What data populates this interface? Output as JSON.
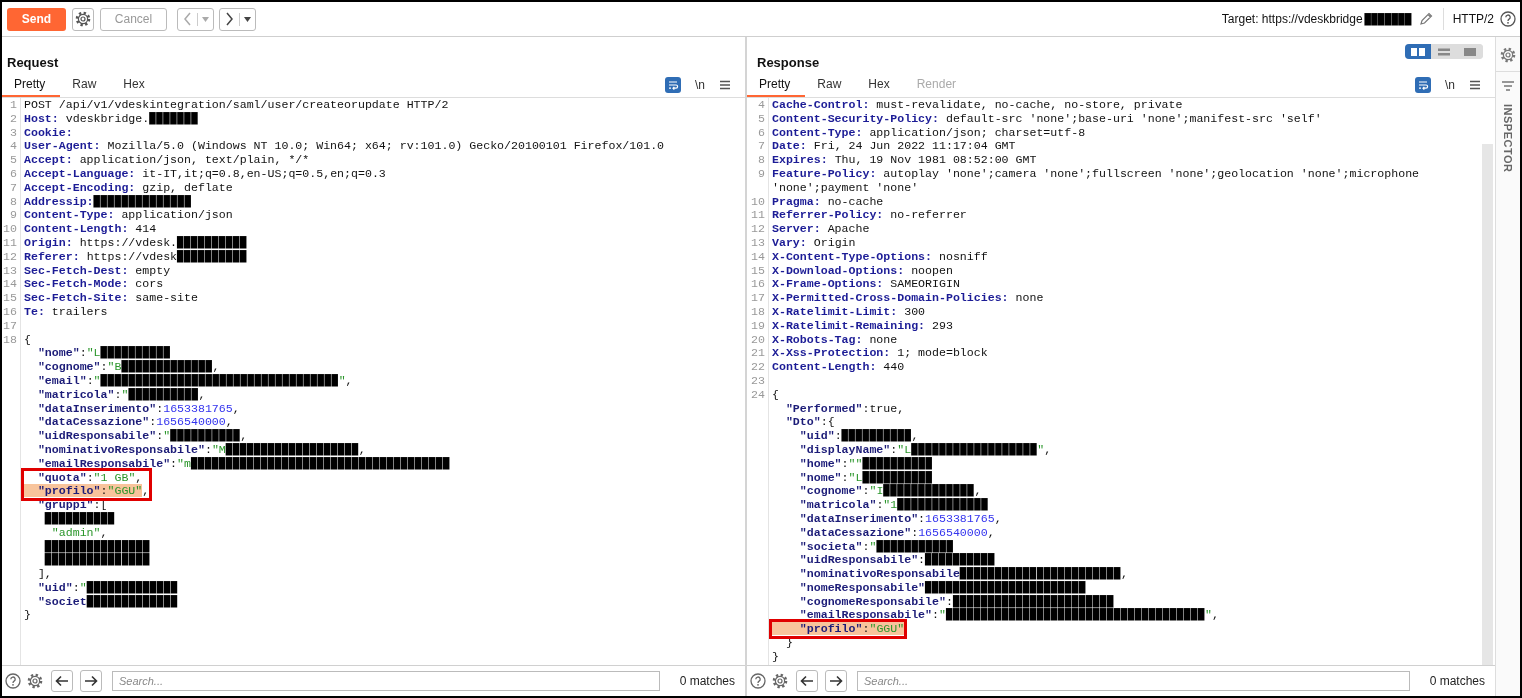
{
  "toolbar": {
    "send": {
      "label": "Send"
    },
    "cancel": {
      "label": "Cancel",
      "disabled": true
    },
    "history": [
      {
        "kind": "back",
        "disabled": true
      },
      {
        "kind": "forward",
        "disabled": false
      }
    ],
    "target": {
      "label": "Target: https://vdeskbridge",
      "redaction": "███████"
    },
    "protocol": "HTTP/2"
  },
  "request": {
    "kind": "request",
    "title": "Request",
    "tabs": [
      {
        "label": "Pretty",
        "selected": true
      },
      {
        "label": "Raw",
        "selected": false
      },
      {
        "label": "Hex",
        "selected": false
      }
    ],
    "newline_toggle": "\\n",
    "lines": [
      {
        "number": "1",
        "tokens": [
          {
            "kind": "text",
            "text": "POST /api/v1/vdeskintegration/saml/user/createorupdate HTTP/2"
          }
        ]
      },
      {
        "number": "2",
        "tokens": [
          {
            "kind": "name",
            "text": "Host:"
          },
          {
            "kind": "text",
            "text": " vdeskbridge."
          },
          {
            "kind": "redacted",
            "text": "███████"
          }
        ]
      },
      {
        "number": "3",
        "tokens": [
          {
            "kind": "name",
            "text": "Cookie:"
          }
        ]
      },
      {
        "number": "4",
        "tokens": [
          {
            "kind": "name",
            "text": "User-Agent:"
          },
          {
            "kind": "text",
            "text": " Mozilla/5.0 (Windows NT 10.0; Win64; x64; rv:101.0) Gecko/20100101 Firefox/101.0"
          }
        ]
      },
      {
        "number": "5",
        "tokens": [
          {
            "kind": "name",
            "text": "Accept:"
          },
          {
            "kind": "text",
            "text": " application/json, text/plain, */*"
          }
        ]
      },
      {
        "number": "6",
        "tokens": [
          {
            "kind": "name",
            "text": "Accept-Language:"
          },
          {
            "kind": "text",
            "text": " it-IT,it;q=0.8,en-US;q=0.5,en;q=0.3"
          }
        ]
      },
      {
        "number": "7",
        "tokens": [
          {
            "kind": "name",
            "text": "Accept-Encoding:"
          },
          {
            "kind": "text",
            "text": " gzip, deflate"
          }
        ]
      },
      {
        "number": "8",
        "tokens": [
          {
            "kind": "name",
            "text": "Addressip:"
          },
          {
            "kind": "redacted",
            "text": "██████████████"
          }
        ]
      },
      {
        "number": "9",
        "tokens": [
          {
            "kind": "name",
            "text": "Content-Type:"
          },
          {
            "kind": "text",
            "text": " application/json"
          }
        ]
      },
      {
        "number": "10",
        "tokens": [
          {
            "kind": "name",
            "text": "Content-Length:"
          },
          {
            "kind": "text",
            "text": " 414"
          }
        ]
      },
      {
        "number": "11",
        "tokens": [
          {
            "kind": "name",
            "text": "Origin:"
          },
          {
            "kind": "text",
            "text": " https://vdesk."
          },
          {
            "kind": "redacted",
            "text": "██████████"
          }
        ]
      },
      {
        "number": "12",
        "tokens": [
          {
            "kind": "name",
            "text": "Referer:"
          },
          {
            "kind": "text",
            "text": " https://vdesk"
          },
          {
            "kind": "redacted",
            "text": "██████████"
          }
        ]
      },
      {
        "number": "13",
        "tokens": [
          {
            "kind": "name",
            "text": "Sec-Fetch-Dest:"
          },
          {
            "kind": "text",
            "text": " empty"
          }
        ]
      },
      {
        "number": "14",
        "tokens": [
          {
            "kind": "name",
            "text": "Sec-Fetch-Mode:"
          },
          {
            "kind": "text",
            "text": " cors"
          }
        ]
      },
      {
        "number": "15",
        "tokens": [
          {
            "kind": "name",
            "text": "Sec-Fetch-Site:"
          },
          {
            "kind": "text",
            "text": " same-site"
          }
        ]
      },
      {
        "number": "16",
        "tokens": [
          {
            "kind": "name",
            "text": "Te:"
          },
          {
            "kind": "text",
            "text": " trailers"
          }
        ]
      },
      {
        "number": "17"
      },
      {
        "number": "18",
        "tokens": [
          {
            "kind": "punct",
            "text": "{"
          }
        ]
      },
      {
        "tokens": [
          {
            "kind": "key",
            "text": "  \"nome\""
          },
          {
            "kind": "punct",
            "text": ":"
          },
          {
            "kind": "string",
            "text": "\"L"
          },
          {
            "kind": "redacted",
            "text": "██████████"
          }
        ]
      },
      {
        "tokens": [
          {
            "kind": "key",
            "text": "  \"cognome\""
          },
          {
            "kind": "punct",
            "text": ":"
          },
          {
            "kind": "string",
            "text": "\"B"
          },
          {
            "kind": "redacted",
            "text": "█████████████"
          },
          {
            "kind": "punct",
            "text": ","
          }
        ]
      },
      {
        "tokens": [
          {
            "kind": "key",
            "text": "  \"email\""
          },
          {
            "kind": "punct",
            "text": ":"
          },
          {
            "kind": "string",
            "text": "\""
          },
          {
            "kind": "redacted",
            "text": "██████████████████████████████████"
          },
          {
            "kind": "string",
            "text": "\""
          },
          {
            "kind": "punct",
            "text": ","
          }
        ]
      },
      {
        "tokens": [
          {
            "kind": "key",
            "text": "  \"matricola\""
          },
          {
            "kind": "punct",
            "text": ":"
          },
          {
            "kind": "string",
            "text": "\""
          },
          {
            "kind": "redacted",
            "text": "██████████"
          },
          {
            "kind": "punct",
            "text": ","
          }
        ]
      },
      {
        "tokens": [
          {
            "kind": "key",
            "text": "  \"dataInserimento\""
          },
          {
            "kind": "punct",
            "text": ":"
          },
          {
            "kind": "number",
            "text": "1653381765"
          },
          {
            "kind": "punct",
            "text": ","
          }
        ]
      },
      {
        "tokens": [
          {
            "kind": "key",
            "text": "  \"dataCessazione\""
          },
          {
            "kind": "punct",
            "text": ":"
          },
          {
            "kind": "number",
            "text": "1656540000"
          },
          {
            "kind": "punct",
            "text": ","
          }
        ]
      },
      {
        "tokens": [
          {
            "kind": "key",
            "text": "  \"uidResponsabile\""
          },
          {
            "kind": "punct",
            "text": ":"
          },
          {
            "kind": "string",
            "text": "\""
          },
          {
            "kind": "redacted",
            "text": "██████████"
          },
          {
            "kind": "punct",
            "text": ","
          }
        ]
      },
      {
        "tokens": [
          {
            "kind": "key",
            "text": "  \"nominativoResponsabile\""
          },
          {
            "kind": "punct",
            "text": ":"
          },
          {
            "kind": "string",
            "text": "\"M"
          },
          {
            "kind": "redacted",
            "text": "███████████████████"
          },
          {
            "kind": "punct",
            "text": ","
          }
        ]
      },
      {
        "tokens": [
          {
            "kind": "key",
            "text": "  \"emailResponsabile\""
          },
          {
            "kind": "punct",
            "text": ":"
          },
          {
            "kind": "string",
            "text": "\"m"
          },
          {
            "kind": "redacted",
            "text": "█████████████████████████████████████"
          }
        ]
      },
      {
        "boxed": true,
        "tokens": [
          {
            "kind": "key",
            "text": "  \"quota\""
          },
          {
            "kind": "punct",
            "text": ":"
          },
          {
            "kind": "string",
            "text": "\"1 GB\""
          },
          {
            "kind": "punct",
            "text": ","
          }
        ]
      },
      {
        "boxed": true,
        "tokens": [
          {
            "kind": "key",
            "text": "  \"profilo\"",
            "highlighted": true
          },
          {
            "kind": "punct",
            "text": ":",
            "highlighted": true
          },
          {
            "kind": "string",
            "text": "\"GGU\"",
            "highlighted": true
          },
          {
            "kind": "punct",
            "text": ","
          }
        ]
      },
      {
        "tokens": [
          {
            "kind": "key",
            "text": "  \"gruppi\""
          },
          {
            "kind": "punct",
            "text": ":["
          }
        ]
      },
      {
        "nested": true,
        "tokens": [
          {
            "kind": "redacted",
            "text": "██████████"
          }
        ]
      },
      {
        "tokens": [
          {
            "kind": "string",
            "text": "    \"admin\""
          },
          {
            "kind": "punct",
            "text": ","
          }
        ]
      },
      {
        "nested": true,
        "tokens": [
          {
            "kind": "redacted",
            "text": "███████████████"
          }
        ]
      },
      {
        "nested": true,
        "tokens": [
          {
            "kind": "redacted",
            "text": "███████████████"
          }
        ]
      },
      {
        "tokens": [
          {
            "kind": "punct",
            "text": "  ],"
          }
        ]
      },
      {
        "tokens": [
          {
            "kind": "key",
            "text": "  \"uid\""
          },
          {
            "kind": "punct",
            "text": ":"
          },
          {
            "kind": "string",
            "text": "\""
          },
          {
            "kind": "redacted",
            "text": "█████████████"
          }
        ]
      },
      {
        "tokens": [
          {
            "kind": "key",
            "text": "  \"societ"
          },
          {
            "kind": "redacted",
            "text": "█████████████"
          }
        ]
      },
      {
        "tokens": [
          {
            "kind": "punct",
            "text": "}"
          }
        ]
      }
    ],
    "search": {
      "placeholder": "Search..."
    },
    "matches": "0 matches"
  },
  "response": {
    "kind": "response",
    "title": "Response",
    "layout_modes": [
      {
        "kind": "columns",
        "selected": true
      },
      {
        "kind": "rows",
        "selected": false
      },
      {
        "kind": "single",
        "selected": false
      }
    ],
    "tabs": [
      {
        "label": "Pretty",
        "selected": true,
        "disabled": false
      },
      {
        "label": "Raw",
        "selected": false,
        "disabled": false
      },
      {
        "label": "Hex",
        "selected": false,
        "disabled": false
      },
      {
        "label": "Render",
        "selected": false,
        "disabled": true
      }
    ],
    "newline_toggle": "\\n",
    "lines": [
      {
        "number": "4",
        "tokens": [
          {
            "kind": "name",
            "text": "Cache-Control:"
          },
          {
            "kind": "text",
            "text": " must-revalidate, no-cache, no-store, private"
          }
        ]
      },
      {
        "number": "5",
        "tokens": [
          {
            "kind": "name",
            "text": "Content-Security-Policy:"
          },
          {
            "kind": "text",
            "text": " default-src 'none';base-uri 'none';manifest-src 'self'"
          }
        ]
      },
      {
        "number": "6",
        "tokens": [
          {
            "kind": "name",
            "text": "Content-Type:"
          },
          {
            "kind": "text",
            "text": " application/json; charset=utf-8"
          }
        ]
      },
      {
        "number": "7",
        "tokens": [
          {
            "kind": "name",
            "text": "Date:"
          },
          {
            "kind": "text",
            "text": " Fri, 24 Jun 2022 11:17:04 GMT"
          }
        ]
      },
      {
        "number": "8",
        "tokens": [
          {
            "kind": "name",
            "text": "Expires:"
          },
          {
            "kind": "text",
            "text": " Thu, 19 Nov 1981 08:52:00 GMT"
          }
        ]
      },
      {
        "number": "9",
        "tokens": [
          {
            "kind": "name",
            "text": "Feature-Policy:"
          },
          {
            "kind": "text",
            "text": " autoplay 'none';camera 'none';fullscreen 'none';geolocation 'none';microphone"
          }
        ]
      },
      {
        "tokens": [
          {
            "kind": "text",
            "text": "'none';payment 'none'"
          }
        ]
      },
      {
        "number": "10",
        "tokens": [
          {
            "kind": "name",
            "text": "Pragma:"
          },
          {
            "kind": "text",
            "text": " no-cache"
          }
        ]
      },
      {
        "number": "11",
        "tokens": [
          {
            "kind": "name",
            "text": "Referrer-Policy:"
          },
          {
            "kind": "text",
            "text": " no-referrer"
          }
        ]
      },
      {
        "number": "12",
        "tokens": [
          {
            "kind": "name",
            "text": "Server:"
          },
          {
            "kind": "text",
            "text": " Apache"
          }
        ]
      },
      {
        "number": "13",
        "tokens": [
          {
            "kind": "name",
            "text": "Vary:"
          },
          {
            "kind": "text",
            "text": " Origin"
          }
        ]
      },
      {
        "number": "14",
        "tokens": [
          {
            "kind": "name",
            "text": "X-Content-Type-Options:"
          },
          {
            "kind": "text",
            "text": " nosniff"
          }
        ]
      },
      {
        "number": "15",
        "tokens": [
          {
            "kind": "name",
            "text": "X-Download-Options:"
          },
          {
            "kind": "text",
            "text": " noopen"
          }
        ]
      },
      {
        "number": "16",
        "tokens": [
          {
            "kind": "name",
            "text": "X-Frame-Options:"
          },
          {
            "kind": "text",
            "text": " SAMEORIGIN"
          }
        ]
      },
      {
        "number": "17",
        "tokens": [
          {
            "kind": "name",
            "text": "X-Permitted-Cross-Domain-Policies:"
          },
          {
            "kind": "text",
            "text": " none"
          }
        ]
      },
      {
        "number": "18",
        "tokens": [
          {
            "kind": "name",
            "text": "X-Ratelimit-Limit:"
          },
          {
            "kind": "text",
            "text": " 300"
          }
        ]
      },
      {
        "number": "19",
        "tokens": [
          {
            "kind": "name",
            "text": "X-Ratelimit-Remaining:"
          },
          {
            "kind": "text",
            "text": " 293"
          }
        ]
      },
      {
        "number": "20",
        "tokens": [
          {
            "kind": "name",
            "text": "X-Robots-Tag:"
          },
          {
            "kind": "text",
            "text": " none"
          }
        ]
      },
      {
        "number": "21",
        "tokens": [
          {
            "kind": "name",
            "text": "X-Xss-Protection:"
          },
          {
            "kind": "text",
            "text": " 1; mode=block"
          }
        ]
      },
      {
        "number": "22",
        "tokens": [
          {
            "kind": "name",
            "text": "Content-Length:"
          },
          {
            "kind": "text",
            "text": " 440"
          }
        ]
      },
      {
        "number": "23"
      },
      {
        "number": "24",
        "tokens": [
          {
            "kind": "punct",
            "text": "{"
          }
        ]
      },
      {
        "tokens": [
          {
            "kind": "key",
            "text": "  \"Performed\""
          },
          {
            "kind": "punct",
            "text": ":true,"
          }
        ]
      },
      {
        "tokens": [
          {
            "kind": "key",
            "text": "  \"Dto\""
          },
          {
            "kind": "punct",
            "text": ":{"
          }
        ]
      },
      {
        "tokens": [
          {
            "kind": "key",
            "text": "    \"uid\""
          },
          {
            "kind": "punct",
            "text": ":"
          },
          {
            "kind": "redacted",
            "text": "██████████"
          },
          {
            "kind": "punct",
            "text": ","
          }
        ]
      },
      {
        "tokens": [
          {
            "kind": "key",
            "text": "    \"displayName\""
          },
          {
            "kind": "punct",
            "text": ":"
          },
          {
            "kind": "string",
            "text": "\"L"
          },
          {
            "kind": "redacted",
            "text": "██████████████████"
          },
          {
            "kind": "string",
            "text": "\""
          },
          {
            "kind": "punct",
            "text": ","
          }
        ]
      },
      {
        "tokens": [
          {
            "kind": "key",
            "text": "    \"home\""
          },
          {
            "kind": "punct",
            "text": ":"
          },
          {
            "kind": "string",
            "text": "\"\""
          },
          {
            "kind": "redacted",
            "text": "██████████"
          }
        ]
      },
      {
        "tokens": [
          {
            "kind": "key",
            "text": "    \"nome\""
          },
          {
            "kind": "punct",
            "text": ":"
          },
          {
            "kind": "string",
            "text": "\"L"
          },
          {
            "kind": "redacted",
            "text": "██████████"
          }
        ]
      },
      {
        "tokens": [
          {
            "kind": "key",
            "text": "    \"cognome\""
          },
          {
            "kind": "punct",
            "text": ":"
          },
          {
            "kind": "string",
            "text": "\"I"
          },
          {
            "kind": "redacted",
            "text": "█████████████"
          },
          {
            "kind": "punct",
            "text": ","
          }
        ]
      },
      {
        "tokens": [
          {
            "kind": "key",
            "text": "    \"matricola\""
          },
          {
            "kind": "punct",
            "text": ":"
          },
          {
            "kind": "string",
            "text": "\"1"
          },
          {
            "kind": "redacted",
            "text": "█████████████"
          }
        ]
      },
      {
        "tokens": [
          {
            "kind": "key",
            "text": "    \"dataInserimento\""
          },
          {
            "kind": "punct",
            "text": ":"
          },
          {
            "kind": "number",
            "text": "1653381765"
          },
          {
            "kind": "punct",
            "text": ","
          }
        ]
      },
      {
        "tokens": [
          {
            "kind": "key",
            "text": "    \"dataCessazione\""
          },
          {
            "kind": "punct",
            "text": ":"
          },
          {
            "kind": "number",
            "text": "1656540000"
          },
          {
            "kind": "punct",
            "text": ","
          }
        ]
      },
      {
        "tokens": [
          {
            "kind": "key",
            "text": "    \"societa\""
          },
          {
            "kind": "punct",
            "text": ":"
          },
          {
            "kind": "string",
            "text": "\""
          },
          {
            "kind": "redacted",
            "text": "███████████"
          }
        ]
      },
      {
        "tokens": [
          {
            "kind": "key",
            "text": "    \"uidResponsabile\""
          },
          {
            "kind": "punct",
            "text": ":"
          },
          {
            "kind": "redacted",
            "text": "██████████"
          }
        ]
      },
      {
        "tokens": [
          {
            "kind": "key",
            "text": "    \"nominativoResponsabile"
          },
          {
            "kind": "redacted",
            "text": "███████████████████████"
          },
          {
            "kind": "punct",
            "text": ","
          }
        ]
      },
      {
        "tokens": [
          {
            "kind": "key",
            "text": "    \"nomeResponsabile\""
          },
          {
            "kind": "redacted",
            "text": "███████████████████████"
          }
        ]
      },
      {
        "tokens": [
          {
            "kind": "key",
            "text": "    \"cognomeResponsabile\""
          },
          {
            "kind": "punct",
            "text": ":"
          },
          {
            "kind": "redacted",
            "text": "███████████████████████"
          }
        ]
      },
      {
        "tokens": [
          {
            "kind": "key",
            "text": "    \"emailResponsabile\""
          },
          {
            "kind": "punct",
            "text": ":"
          },
          {
            "kind": "string",
            "text": "\""
          },
          {
            "kind": "redacted",
            "text": "█████████████████████████████████████"
          },
          {
            "kind": "string",
            "text": "\""
          },
          {
            "kind": "punct",
            "text": ","
          }
        ]
      },
      {
        "boxed": true,
        "tokens": [
          {
            "kind": "key",
            "text": "    \"profilo\"",
            "highlighted": true
          },
          {
            "kind": "punct",
            "text": ":",
            "highlighted": true
          },
          {
            "kind": "string",
            "text": "\"GGU\"",
            "highlighted": true
          }
        ]
      },
      {
        "tokens": [
          {
            "kind": "punct",
            "text": "  }"
          }
        ]
      },
      {
        "tokens": [
          {
            "kind": "punct",
            "text": "}"
          }
        ]
      }
    ],
    "search": {
      "placeholder": "Search..."
    },
    "matches": "0 matches"
  },
  "inspector": {
    "label": "INSPECTOR"
  }
}
